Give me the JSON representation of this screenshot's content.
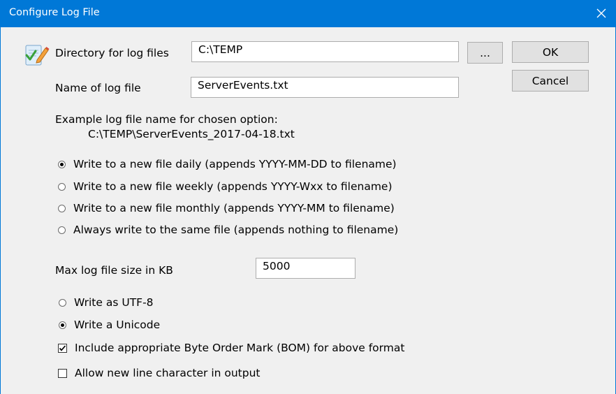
{
  "window": {
    "title": "Configure Log File"
  },
  "fields": {
    "directory": {
      "label": "Directory for log files",
      "value": "C:\\TEMP"
    },
    "filename": {
      "label": "Name of log file",
      "value": "ServerEvents.txt"
    },
    "maxsize": {
      "label": "Max log file size in KB",
      "value": "5000"
    }
  },
  "buttons": {
    "browse": "...",
    "ok": "OK",
    "cancel": "Cancel"
  },
  "example": {
    "heading": "Example log file name for chosen option:",
    "value": "C:\\TEMP\\ServerEvents_2017-04-18.txt"
  },
  "rotation": {
    "selected": "daily",
    "options": [
      {
        "id": "daily",
        "label": "Write to a new file daily (appends YYYY-MM-DD to filename)",
        "checked": true
      },
      {
        "id": "weekly",
        "label": "Write to a new file weekly (appends YYYY-Wxx to filename)",
        "checked": false
      },
      {
        "id": "monthly",
        "label": "Write to a new file monthly (appends YYYY-MM to filename)",
        "checked": false
      },
      {
        "id": "same",
        "label": "Always write to the same file (appends nothing to filename)",
        "checked": false
      }
    ]
  },
  "encoding": {
    "options": [
      {
        "id": "utf8",
        "label": "Write as UTF-8",
        "checked": false
      },
      {
        "id": "unicode",
        "label": "Write a Unicode",
        "checked": true
      }
    ]
  },
  "checkboxes": [
    {
      "id": "bom",
      "label": "Include appropriate Byte Order Mark (BOM) for above format",
      "checked": true
    },
    {
      "id": "newline",
      "label": "Allow new line character in output",
      "checked": false
    }
  ],
  "colors": {
    "titlebar": "#0078d7",
    "background": "#f0f0f0"
  },
  "icons": {
    "app": "edit-document-checkmark-icon",
    "close": "close-icon"
  }
}
